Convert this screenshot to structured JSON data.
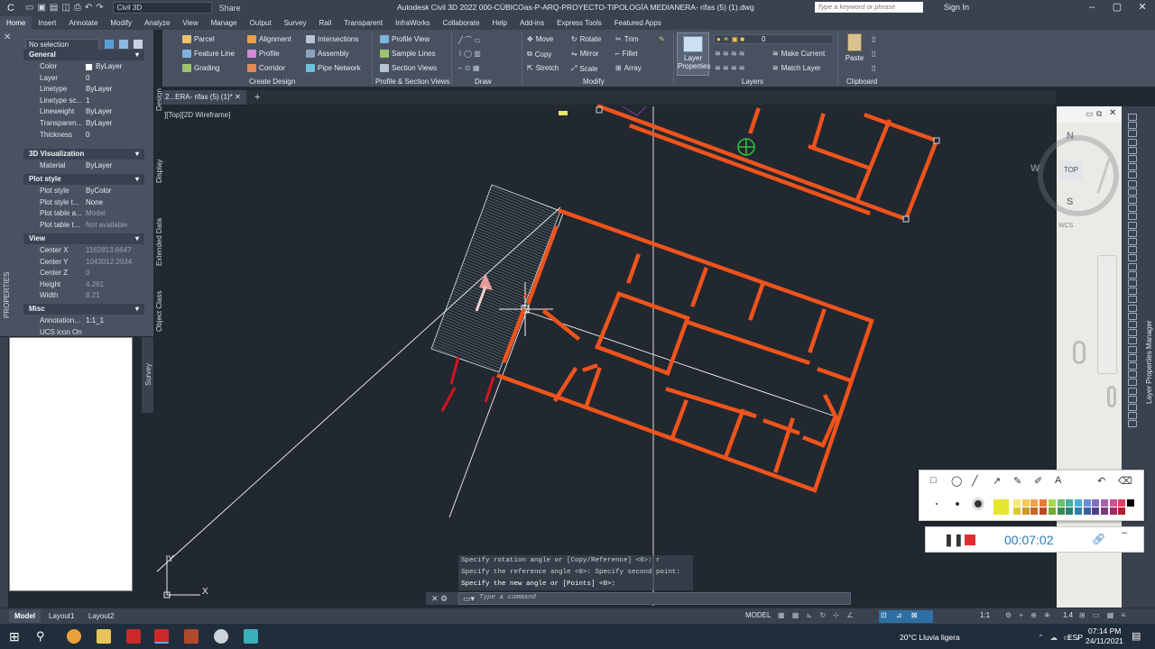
{
  "titlebar": {
    "workspace": "Civil 3D",
    "share": "Share",
    "title": "Autodesk Civil 3D 2022    000-CÚBICOas-P-ARQ-PROYECTO-TIPOLOGÍA MEDIANERA- rifas (5) (1).dwg",
    "search_placeholder": "Type a keyword or phrase",
    "sign_in": "Sign In"
  },
  "menu": {
    "tabs": [
      "Home",
      "Insert",
      "Annotate",
      "Modify",
      "Analyze",
      "View",
      "Manage",
      "Output",
      "Survey",
      "Rail",
      "Transparent",
      "InfraWorks",
      "Collaborate",
      "Help",
      "Add-ins",
      "Express Tools",
      "Featured Apps"
    ],
    "active": "Home"
  },
  "ribbon": {
    "create_design": {
      "label": "Create Design",
      "items": [
        "Parcel",
        "Feature Line",
        "Grading",
        "Alignment",
        "Profile",
        "Corridor",
        "Intersections",
        "Assembly",
        "Pipe Network"
      ]
    },
    "profile_section": {
      "label": "Profile & Section Views",
      "items": [
        "Profile View",
        "Sample Lines",
        "Section Views"
      ]
    },
    "draw": {
      "label": "Draw"
    },
    "modify": {
      "label": "Modify",
      "items": [
        "Move",
        "Copy",
        "Stretch",
        "Rotate",
        "Mirror",
        "Scale",
        "Trim",
        "Fillet",
        "Array"
      ]
    },
    "layers": {
      "label": "Layers",
      "layer_properties": "Layer Properties",
      "current_layer": "0",
      "make_current": "Make Current",
      "match_layer": "Match Layer"
    },
    "clipboard": {
      "label": "Clipboard",
      "paste": "Paste"
    }
  },
  "properties": {
    "selection": "No selection",
    "side_label": "PROPERTIES",
    "sections": {
      "general": "General",
      "visualization": "3D Visualization",
      "plot_style": "Plot style",
      "view": "View",
      "misc": "Misc"
    },
    "general_rows": [
      {
        "key": "Color",
        "value": "ByLayer"
      },
      {
        "key": "Layer",
        "value": "0"
      },
      {
        "key": "Linetype",
        "value": "ByLayer"
      },
      {
        "key": "Linetype sc...",
        "value": "1"
      },
      {
        "key": "Lineweight",
        "value": "ByLayer"
      },
      {
        "key": "Transparen...",
        "value": "ByLayer"
      },
      {
        "key": "Thickness",
        "value": "0"
      }
    ],
    "vis_rows": [
      {
        "key": "Material",
        "value": "ByLayer"
      }
    ],
    "plot_rows": [
      {
        "key": "Plot style",
        "value": "ByColor"
      },
      {
        "key": "Plot style t...",
        "value": "None"
      },
      {
        "key": "Plot table a...",
        "value": "Model"
      },
      {
        "key": "Plot table t...",
        "value": "Not available"
      }
    ],
    "view_rows": [
      {
        "key": "Center X",
        "value": "1162813.6647"
      },
      {
        "key": "Center Y",
        "value": "1043012.2934"
      },
      {
        "key": "Center Z",
        "value": "0"
      },
      {
        "key": "Height",
        "value": "4.261"
      },
      {
        "key": "Width",
        "value": "8.21"
      }
    ],
    "misc_rows": [
      {
        "key": "Annotation...",
        "value": "1:1_1"
      },
      {
        "key": "UCS icon On",
        "value": ""
      }
    ],
    "side_tabs": [
      "Design",
      "Display",
      "Extended Data",
      "Object Class"
    ],
    "survey_tab": "Survey"
  },
  "document": {
    "tab": "2...ERA- rifas (5) (1)*",
    "viewport_label": "][Top][2D Wireframe]"
  },
  "viewcube": {
    "north": "N",
    "west": "W",
    "top": "TOP",
    "south": "S",
    "wcs": "WCS"
  },
  "right_panel_label": "Layer Properties Manager",
  "command": {
    "history": [
      "Specify rotation angle or [Copy/Reference] <0>: r",
      "Specify the reference angle <0>:  Specify second point:",
      "Specify the new angle or [Points] <0>:"
    ],
    "placeholder": "Type a command"
  },
  "recorder": {
    "time": "00:07:02"
  },
  "statusbar": {
    "tabs": [
      "Model",
      "Layout1",
      "Layout2"
    ],
    "active_tab": "Model",
    "model": "MODEL",
    "scale": "1:1",
    "annot": "1.4"
  },
  "taskbar": {
    "weather": "20°C  Lluvia ligera",
    "lang": "ESP",
    "time": "07:14 PM",
    "date": "24/11/2021"
  },
  "colors": {
    "walls": "#f0531c",
    "background": "#212830",
    "ribbon": "#495161",
    "accent": "#2a7ab8"
  }
}
